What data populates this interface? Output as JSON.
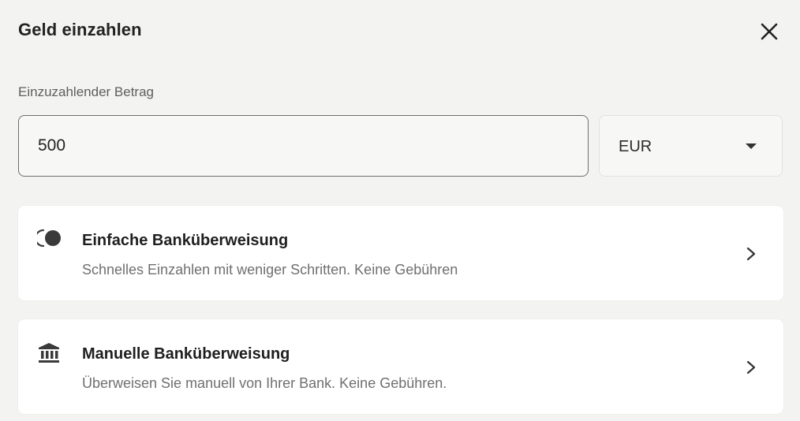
{
  "dialog": {
    "title": "Geld einzahlen",
    "close_icon": "close-icon"
  },
  "amount": {
    "label": "Einzuzahlender Betrag",
    "value": "500"
  },
  "currency": {
    "selected": "EUR",
    "caret_icon": "caret-down-icon"
  },
  "options": [
    {
      "title": "Einfache Banküberweisung",
      "description": "Schnelles Einzahlen mit weniger Schritten. Keine Gebühren",
      "icon": "quick-transfer-icon"
    },
    {
      "title": "Manuelle Banküberweisung",
      "description": "Überweisen Sie manuell von Ihrer Bank. Keine Gebühren.",
      "icon": "bank-icon"
    }
  ],
  "colors": {
    "background": "#f3f3f2",
    "card": "#ffffff",
    "text_primary": "#1f1f1f",
    "text_secondary": "#6f6f6f",
    "input_border": "#6e6e6e"
  }
}
